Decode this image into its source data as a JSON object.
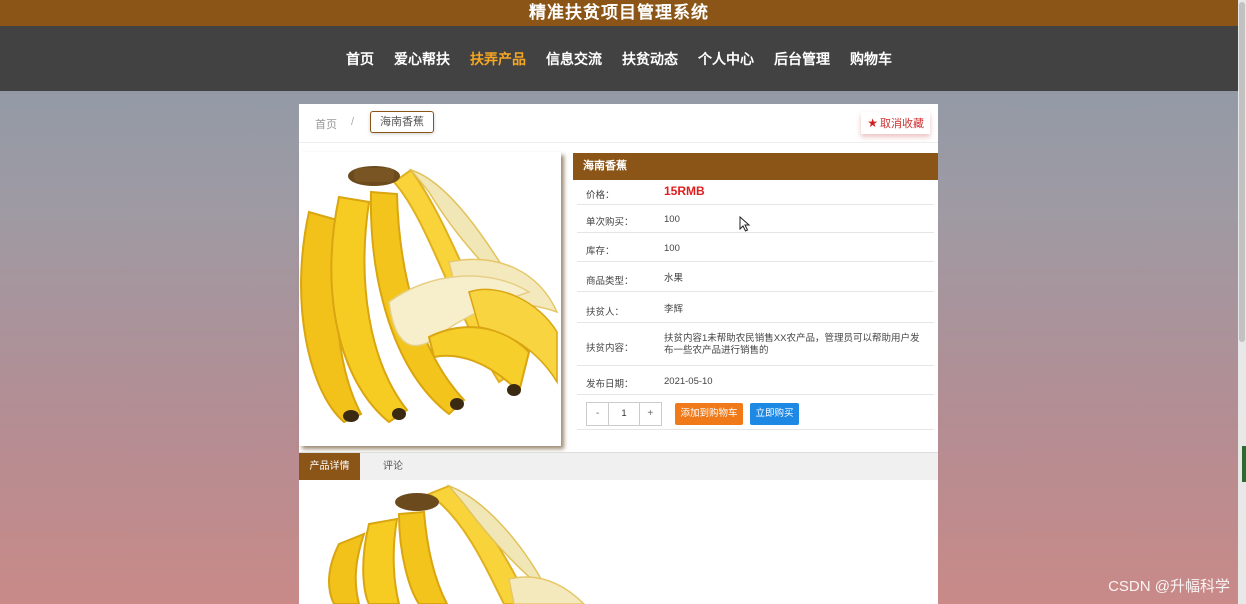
{
  "app": {
    "title": "精准扶贫项目管理系统"
  },
  "nav": {
    "items": [
      {
        "label": "首页"
      },
      {
        "label": "爱心帮扶"
      },
      {
        "label": "扶弄产品",
        "active": true
      },
      {
        "label": "信息交流"
      },
      {
        "label": "扶贫动态"
      },
      {
        "label": "个人中心"
      },
      {
        "label": "后台管理"
      },
      {
        "label": "购物车"
      }
    ]
  },
  "breadcrumb": {
    "home": "首页",
    "separator": "/",
    "current": "海南香蕉"
  },
  "favorite": {
    "label": "取消收藏",
    "icon": "star-icon"
  },
  "product": {
    "name": "海南香蕉",
    "fields": [
      {
        "label": "价格：",
        "value": "15RMB"
      },
      {
        "label": "单次购买：",
        "value": "100"
      },
      {
        "label": "库存：",
        "value": "100"
      },
      {
        "label": "商品类型：",
        "value": "水果"
      },
      {
        "label": "扶贫人：",
        "value": "李辉"
      },
      {
        "label": "扶贫内容：",
        "value": "扶贫内容1未帮助农民销售XX农产品，管理员可以帮助用户发布一些农产品进行销售的"
      },
      {
        "label": "发布日期：",
        "value": "2021-05-10"
      }
    ]
  },
  "purchase": {
    "minus": "-",
    "quantity": "1",
    "plus": "+",
    "add_to_cart": "添加到购物车",
    "buy_now": "立即购买"
  },
  "tabs": [
    {
      "label": "产品详情",
      "active": true
    },
    {
      "label": "评论"
    }
  ],
  "watermark": "CSDN @升幅科学",
  "colors": {
    "brand": "#8a5516",
    "nav_bg": "#424242",
    "active_nav": "#f5a623",
    "price": "#e02020",
    "cart_button": "#f07a1a",
    "buy_button": "#1e88e5"
  }
}
